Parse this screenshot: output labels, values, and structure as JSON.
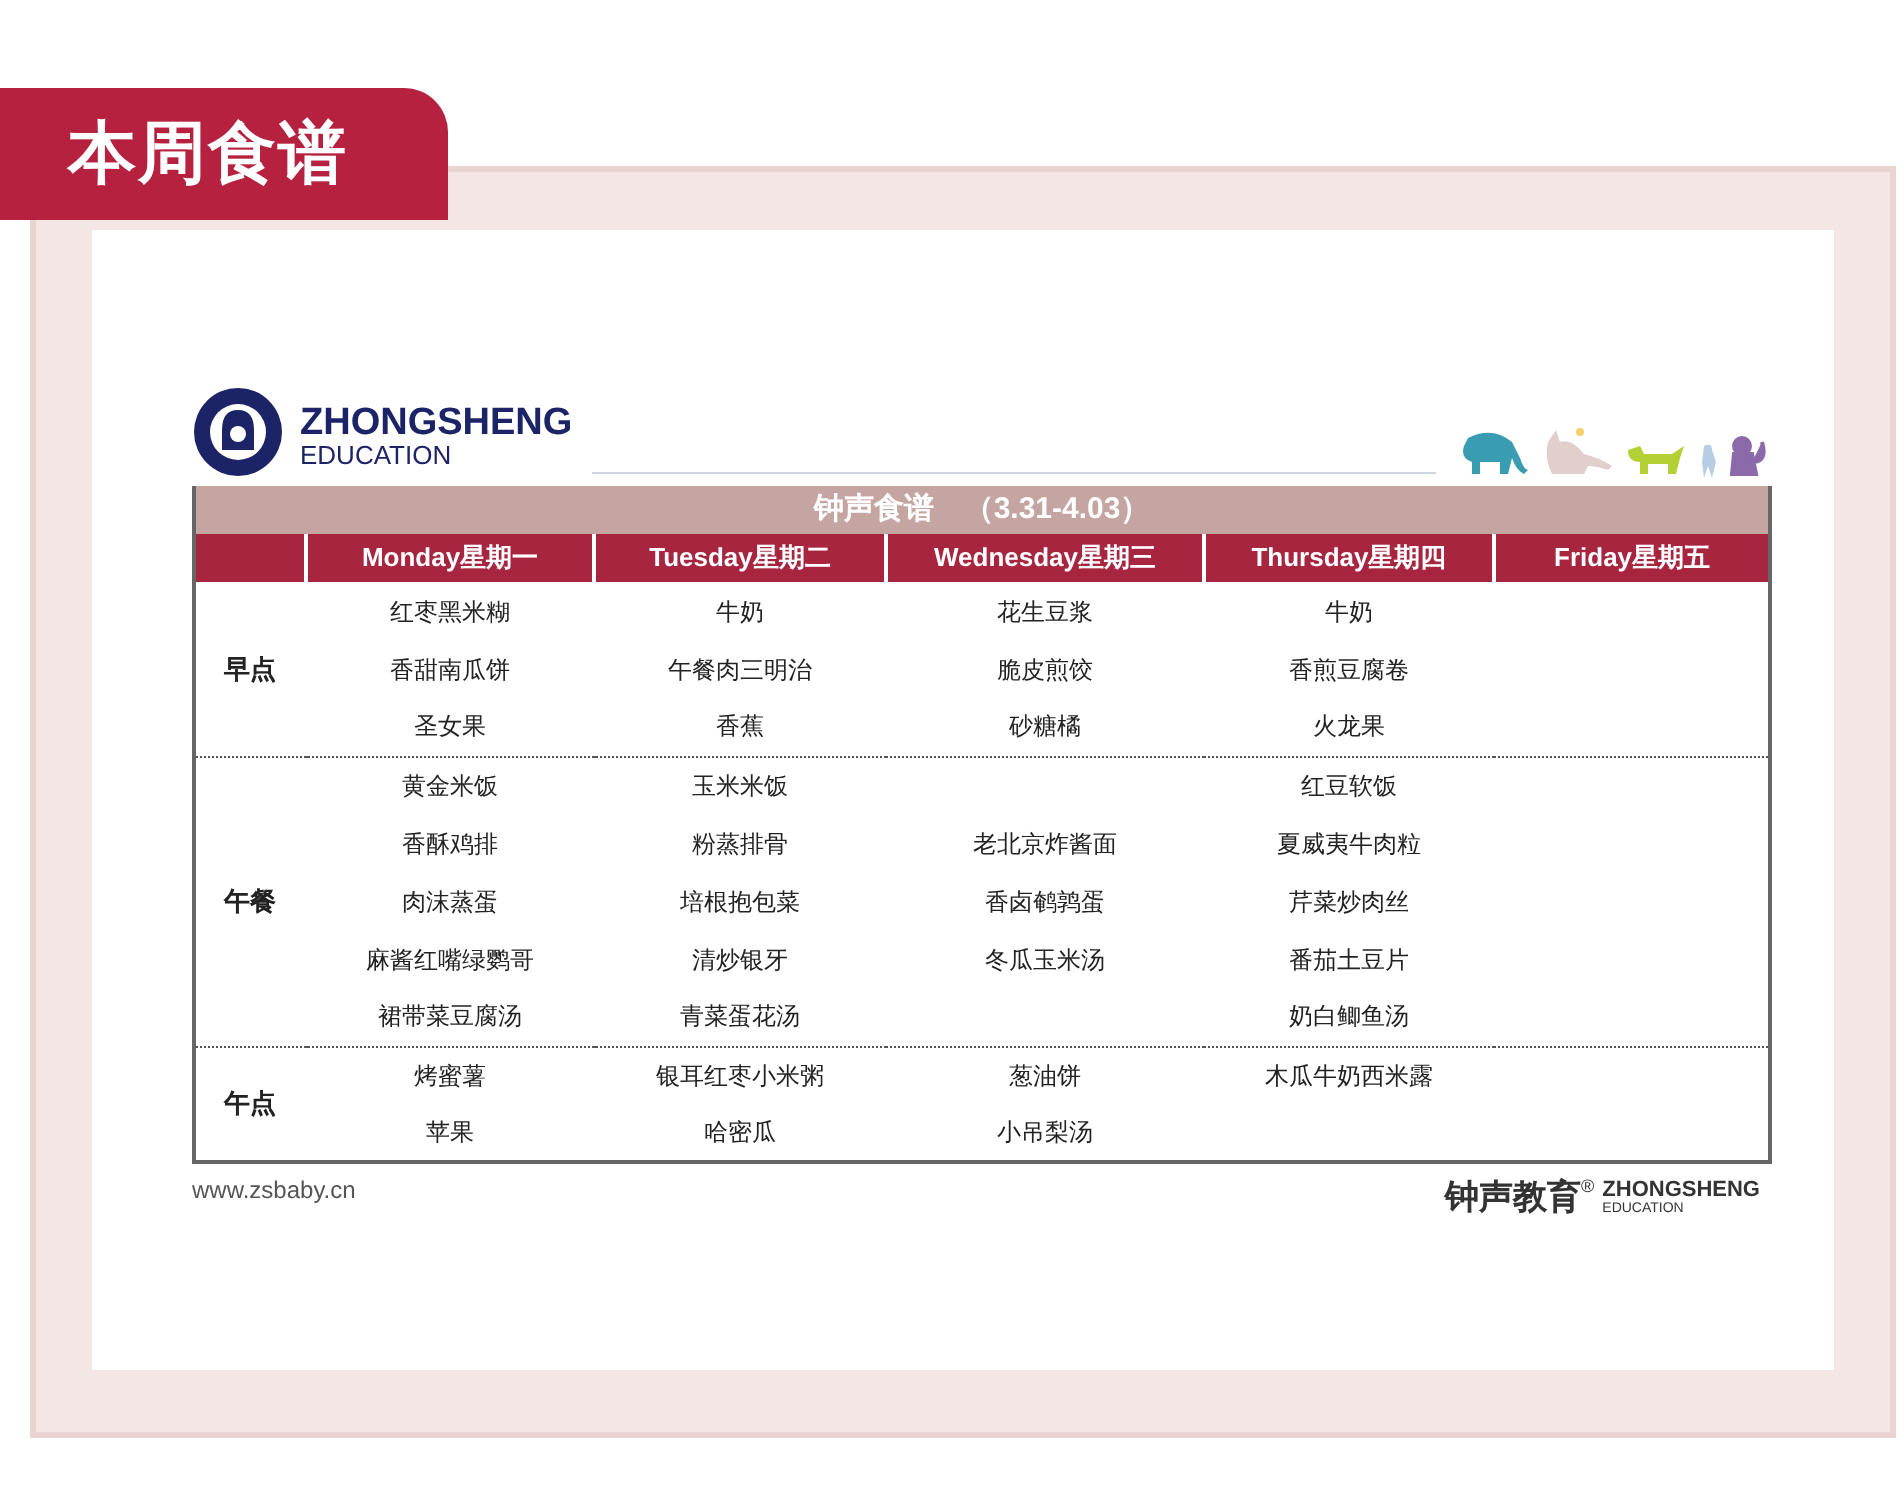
{
  "tab": {
    "label": "本周食谱"
  },
  "logo": {
    "name": "ZHONGSHENG",
    "sub": "EDUCATION"
  },
  "menu_title": "钟声食谱　（3.31-4.03）",
  "columns": [
    "Monday星期一",
    "Tuesday星期二",
    "Wednesday星期三",
    "Thursday星期四",
    "Friday星期五"
  ],
  "sections": [
    {
      "label": "早点",
      "rows": [
        [
          "红枣黑米糊",
          "牛奶",
          "花生豆浆",
          "牛奶",
          null
        ],
        [
          "香甜南瓜饼",
          "午餐肉三明治",
          "脆皮煎饺",
          "香煎豆腐卷",
          null
        ],
        [
          "圣女果",
          "香蕉",
          "砂糖橘",
          "火龙果",
          null
        ]
      ]
    },
    {
      "label": "午餐",
      "rows": [
        [
          "黄金米饭",
          "玉米米饭",
          null,
          "红豆软饭",
          null
        ],
        [
          "香酥鸡排",
          "粉蒸排骨",
          "老北京炸酱面",
          "夏威夷牛肉粒",
          null
        ],
        [
          "肉沫蒸蛋",
          "培根抱包菜",
          "香卤鹌鹑蛋",
          "芹菜炒肉丝",
          null
        ],
        [
          "麻酱红嘴绿鹦哥",
          "清炒银牙",
          "冬瓜玉米汤",
          "番茄土豆片",
          null
        ],
        [
          "裙带菜豆腐汤",
          "青菜蛋花汤",
          null,
          "奶白鲫鱼汤",
          null
        ]
      ]
    },
    {
      "label": "午点",
      "rows": [
        [
          "烤蜜薯",
          "银耳红枣小米粥",
          "葱油饼",
          "木瓜牛奶西米露",
          null
        ],
        [
          "苹果",
          "哈密瓜",
          "小吊梨汤",
          null,
          null
        ]
      ]
    }
  ],
  "footer": {
    "url": "www.zsbaby.cn",
    "brand": "钟声教育",
    "mark": "®",
    "brand_en": "ZHONGSHENG",
    "brand_sub": "EDUCATION"
  }
}
